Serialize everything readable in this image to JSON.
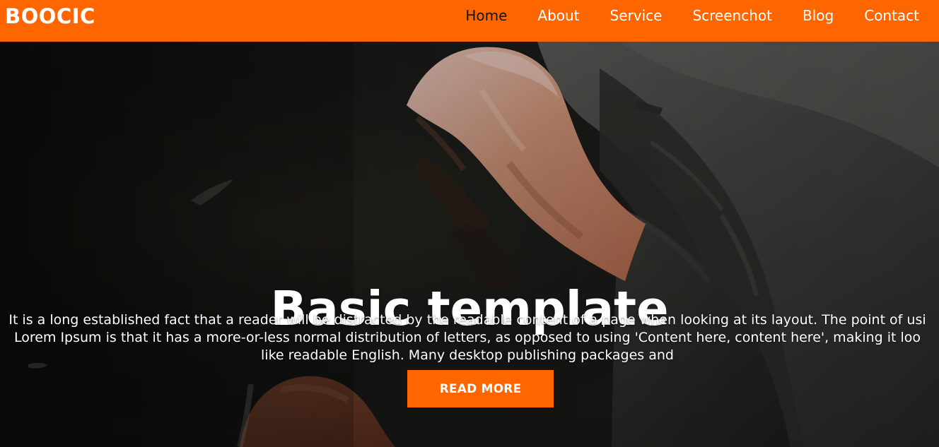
{
  "header": {
    "brand": "BOOCIC",
    "nav_items": [
      "Home",
      "About",
      "Service",
      "Screenchot",
      "Blog",
      "Contact"
    ]
  },
  "hero": {
    "title": "Basic template",
    "description_lines": [
      "It is a long established fact that a reader will be distracted by the readable content of a page when looking at its layout. The point of usi",
      "Lorem Ipsum is that it has a more-or-less normal distribution of letters, as opposed to using 'Content here, content here', making it loo",
      "like readable English. Many desktop publishing packages and"
    ],
    "button_label": "READ MORE"
  },
  "colors": {
    "accent": "#ff6600",
    "text_light": "#ffffff",
    "text_dark": "#161616",
    "hero_dark": "#1f221f"
  }
}
